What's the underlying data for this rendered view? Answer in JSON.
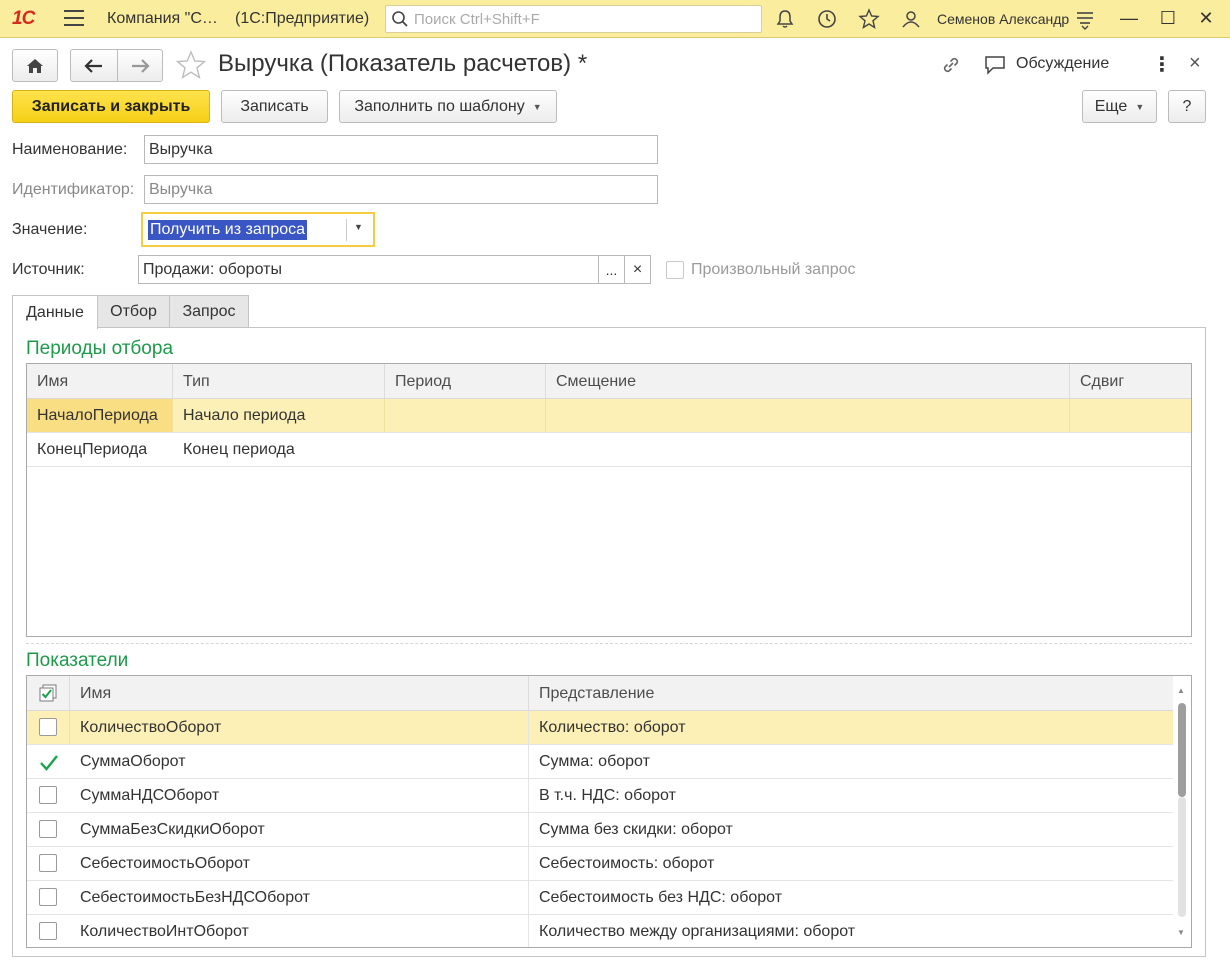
{
  "topbar": {
    "logo": "1С",
    "company": "Компания \"С…",
    "app": "(1С:Предприятие)",
    "search_placeholder": "Поиск Ctrl+Shift+F",
    "user": "Семенов Александр",
    "icons": [
      "bell-icon",
      "history-icon",
      "star-icon",
      "user-icon",
      "settings-lines-icon"
    ],
    "window_controls": {
      "minimize": "—",
      "maximize": "☐",
      "close": "✕"
    },
    "bg_color": "#fbed9e"
  },
  "header": {
    "title": "Выручка (Показатель расчетов) *",
    "discussion": "Обсуждение",
    "more_dots": "⋮",
    "close": "×"
  },
  "toolbar": {
    "save_close": "Записать и закрыть",
    "save": "Записать",
    "fill_template": "Заполнить по шаблону",
    "more": "Еще",
    "help": "?"
  },
  "fields": {
    "name_label": "Наименование:",
    "name_value": "Выручка",
    "id_label": "Идентификатор:",
    "id_value": "Выручка",
    "value_label": "Значение:",
    "value_value": "Получить из запроса",
    "source_label": "Источник:",
    "source_value": "Продажи: обороты",
    "source_choose": "...",
    "source_clear": "×",
    "custom_query_label": "Произвольный запрос",
    "custom_query_checked": false
  },
  "tabs": [
    {
      "label": "Данные",
      "active": true
    },
    {
      "label": "Отбор",
      "active": false
    },
    {
      "label": "Запрос",
      "active": false
    }
  ],
  "periods": {
    "title": "Периоды отбора",
    "columns": [
      "Имя",
      "Тип",
      "Период",
      "Смещение",
      "Сдвиг"
    ],
    "rows": [
      {
        "name": "НачалоПериода",
        "type": "Начало периода",
        "period": "",
        "offset": "",
        "shift": ""
      },
      {
        "name": "КонецПериода",
        "type": "Конец периода",
        "period": "",
        "offset": "",
        "shift": ""
      }
    ]
  },
  "indicators": {
    "title": "Показатели",
    "columns": [
      "Имя",
      "Представление"
    ],
    "rows": [
      {
        "checked": false,
        "name": "КоличествоОборот",
        "presentation": "Количество: оборот"
      },
      {
        "checked": true,
        "name": "СуммаОборот",
        "presentation": "Сумма: оборот"
      },
      {
        "checked": false,
        "name": "СуммаНДСОборот",
        "presentation": "В т.ч. НДС: оборот"
      },
      {
        "checked": false,
        "name": "СуммаБезСкидкиОборот",
        "presentation": "Сумма без скидки: оборот"
      },
      {
        "checked": false,
        "name": "СебестоимостьОборот",
        "presentation": "Себестоимость: оборот"
      },
      {
        "checked": false,
        "name": "СебестоимостьБезНДСОборот",
        "presentation": "Себестоимость без НДС: оборот"
      },
      {
        "checked": false,
        "name": "КоличествоИнтОборот",
        "presentation": "Количество между организациями: оборот"
      }
    ]
  },
  "colors": {
    "accent_yellow": "#f5cf16",
    "section_green": "#1d9a4a",
    "selection_blue": "#3a56c5",
    "row_highlight": "#fdf0b6",
    "check_green": "#1aa34a"
  }
}
